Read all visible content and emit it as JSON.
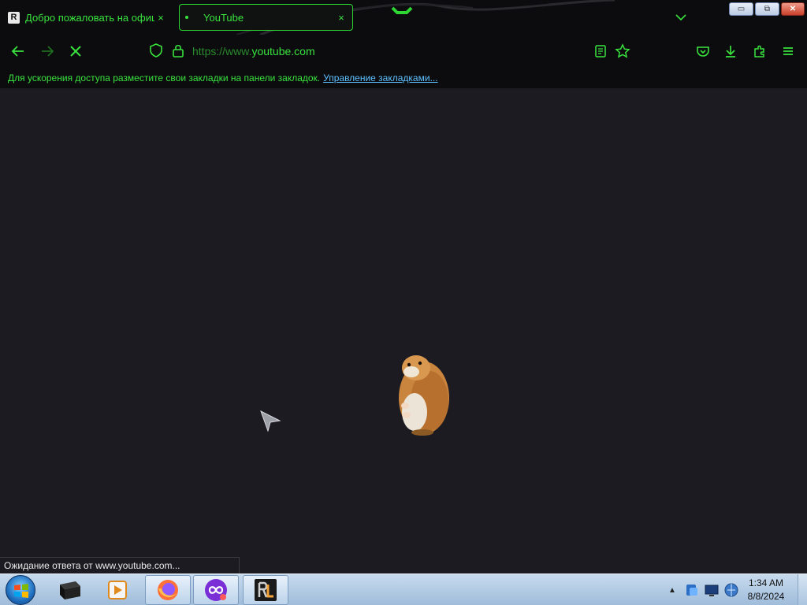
{
  "tabs": [
    {
      "title": "Добро пожаловать на офици",
      "favicon_letter": "R",
      "close": "×",
      "active": false
    },
    {
      "title": "YouTube",
      "close": "×",
      "active": true
    }
  ],
  "window_controls": {
    "minimize": "▭",
    "restore": "⧉",
    "close": "✕"
  },
  "address_bar": {
    "prefix": "https://www.",
    "domain": "youtube.com"
  },
  "bookmarks_bar": {
    "message": "Для ускорения доступа разместите свои закладки на панели закладок.",
    "link": "Управление закладками..."
  },
  "status_bar": {
    "text": "Ожидание ответа от www.youtube.com..."
  },
  "taskbar": {
    "apps": [
      "cmd-icon",
      "media-player-icon",
      "firefox-icon",
      "loop-app-icon",
      "rl-launcher-icon"
    ],
    "tray_arrow": "▲",
    "clock": {
      "time": "1:34 AM",
      "date": "8/8/2024"
    }
  },
  "colors": {
    "accent": "#39e33e",
    "content_bg": "#1c1b22",
    "chrome_bg": "#0c0c0e",
    "link": "#5ec0ff"
  },
  "icons": [
    "back-icon",
    "forward-icon",
    "stop-icon",
    "shield-icon",
    "lock-icon",
    "reader-view-icon",
    "bookmark-star-icon",
    "pocket-icon",
    "download-icon",
    "extensions-icon",
    "menu-icon"
  ]
}
